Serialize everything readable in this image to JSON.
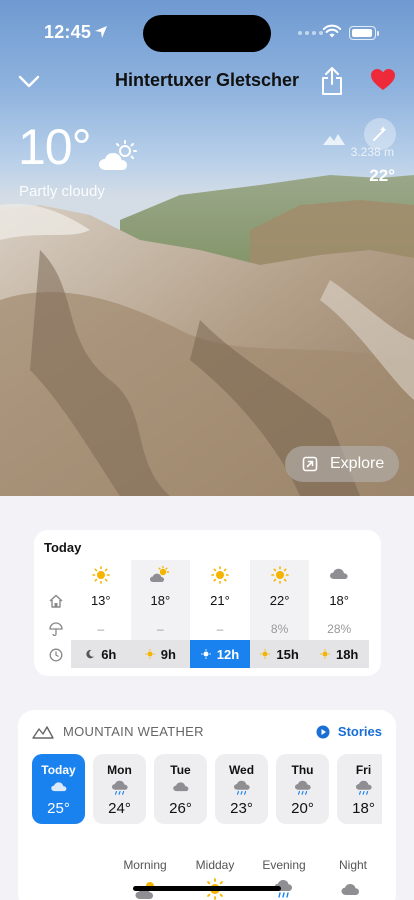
{
  "status": {
    "time": "12:45"
  },
  "header": {
    "title": "Hintertuxer Gletscher"
  },
  "current": {
    "temperature": "10°",
    "condition": "Partly cloudy",
    "altitude": "3.238 m",
    "peak_temperature": "22°"
  },
  "explore_label": "Explore",
  "today": {
    "title": "Today",
    "columns": [
      {
        "icon": "sun-icon",
        "temp": "13°",
        "precip": "–",
        "hour": "6h",
        "hour_icon": "moon-icon"
      },
      {
        "icon": "partly-cloudy-icon",
        "temp": "18°",
        "precip": "–",
        "hour": "9h",
        "hour_icon": "sun-icon"
      },
      {
        "icon": "sun-icon",
        "temp": "21°",
        "precip": "–",
        "hour": "12h",
        "hour_icon": "sun-icon"
      },
      {
        "icon": "sun-icon",
        "temp": "22°",
        "precip": "8%",
        "hour": "15h",
        "hour_icon": "sun-icon"
      },
      {
        "icon": "cloud-icon",
        "temp": "18°",
        "precip": "28%",
        "hour": "18h",
        "hour_icon": "sun-icon"
      }
    ]
  },
  "mountain_weather": {
    "title": "MOUNTAIN WEATHER",
    "stories_label": "Stories",
    "days": [
      {
        "name": "Today",
        "icon": "cloud-icon",
        "temp": "25°"
      },
      {
        "name": "Mon",
        "icon": "rain-icon",
        "temp": "24°"
      },
      {
        "name": "Tue",
        "icon": "cloud-icon",
        "temp": "26°"
      },
      {
        "name": "Wed",
        "icon": "rain-icon",
        "temp": "23°"
      },
      {
        "name": "Thu",
        "icon": "rain-icon",
        "temp": "20°"
      },
      {
        "name": "Fri",
        "icon": "rain-icon",
        "temp": "18°"
      }
    ],
    "dayparts": [
      "Morning",
      "Midday",
      "Evening",
      "Night"
    ]
  },
  "colors": {
    "accent": "#1a82ef",
    "heart": "#ee2a3a",
    "sun": "#f5b400"
  }
}
